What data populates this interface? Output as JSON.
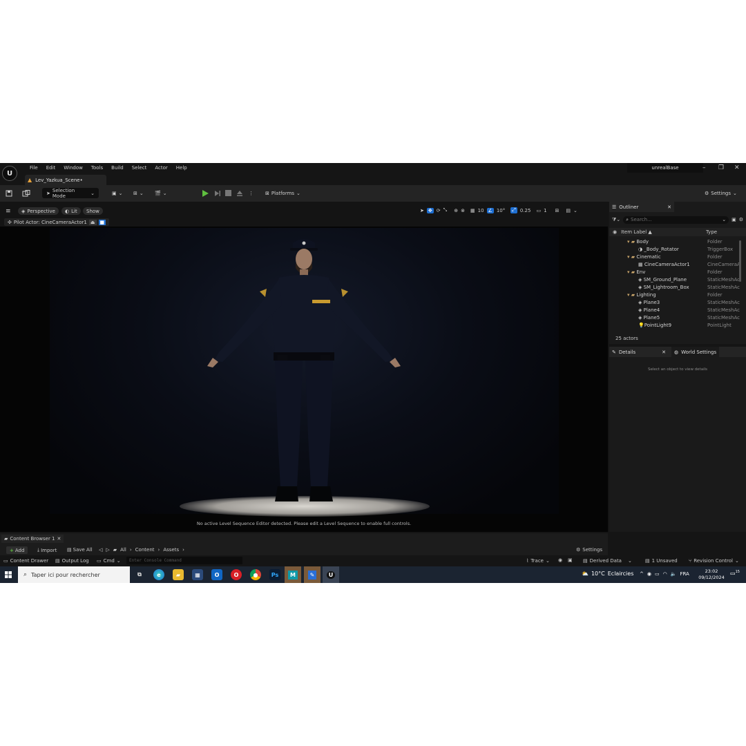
{
  "menu": {
    "items": [
      "File",
      "Edit",
      "Window",
      "Tools",
      "Build",
      "Select",
      "Actor",
      "Help"
    ],
    "project_name": "unrealBase",
    "tab_title": "Lev_Yazkua_Scene•"
  },
  "toolbar": {
    "selection_mode": "Selection Mode",
    "platforms": "Platforms",
    "settings": "Settings"
  },
  "viewport": {
    "perspective": "Perspective",
    "lit": "Lit",
    "show": "Show",
    "pilot_actor": "Pilot Actor: CineCameraActor1",
    "grid_value": "10",
    "angle_value": "10°",
    "scale_value": "0.25",
    "camera_speed": "1",
    "message": "No active Level Sequence Editor detected. Please edit a Level Sequence to enable full controls."
  },
  "outliner": {
    "tab_label": "Outliner",
    "search_placeholder": "Search...",
    "col_label": "Item Label ▲",
    "col_type": "Type",
    "rows": [
      {
        "name": "Body",
        "type": "Folder",
        "folder": true
      },
      {
        "name": "_Body_Rotator",
        "type": "TriggerBox",
        "folder": false
      },
      {
        "name": "Cinematic",
        "type": "Folder",
        "folder": true
      },
      {
        "name": "CineCameraActor1",
        "type": "CineCameraA",
        "folder": false
      },
      {
        "name": "Env",
        "type": "Folder",
        "folder": true
      },
      {
        "name": "SM_Ground_Plane",
        "type": "StaticMeshAc",
        "folder": false
      },
      {
        "name": "SM_Lightroom_Box",
        "type": "StaticMeshAc",
        "folder": false
      },
      {
        "name": "Lighting",
        "type": "Folder",
        "folder": true
      },
      {
        "name": "Plane3",
        "type": "StaticMeshAc",
        "folder": false
      },
      {
        "name": "Plane4",
        "type": "StaticMeshAc",
        "folder": false
      },
      {
        "name": "Plane5",
        "type": "StaticMeshAc",
        "folder": false
      },
      {
        "name": "PointLight9",
        "type": "PointLight",
        "folder": false
      }
    ],
    "actor_count": "25 actors"
  },
  "details": {
    "tab_label": "Details",
    "world_settings": "World Settings",
    "empty_message": "Select an object to view details"
  },
  "content_browser": {
    "tab_label": "Content Browser 1",
    "add": "Add",
    "import": "Import",
    "save_all": "Save All",
    "crumb_all": "All",
    "crumb_content": "Content",
    "crumb_assets": "Assets",
    "settings": "Settings"
  },
  "statusbar": {
    "content_drawer": "Content Drawer",
    "output_log": "Output Log",
    "cmd": "Cmd",
    "console_placeholder": "Enter Console Command",
    "trace": "Trace",
    "derived_data": "Derived Data",
    "unsaved": "1 Unsaved",
    "revision_control": "Revision Control"
  },
  "taskbar": {
    "search_placeholder": "Taper ici pour rechercher",
    "weather_temp": "10°C",
    "weather_desc": "Eclaircies",
    "language": "FRA",
    "time": "23:02",
    "date": "09/12/2024",
    "notif_count": "15"
  },
  "colors": {
    "accent_blue": "#1f6fd1",
    "play_green": "#5fbf3f",
    "folder_tan": "#c8a46a",
    "taskbar_bg": "#1b2431"
  }
}
